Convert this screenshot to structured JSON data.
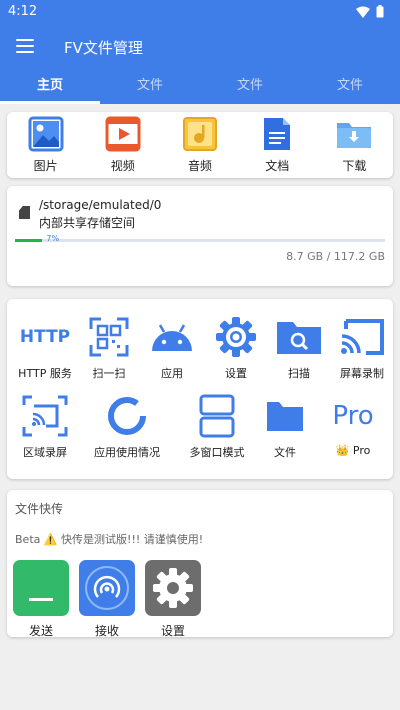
{
  "status": {
    "time": "4:12"
  },
  "app": {
    "title": "FV文件管理"
  },
  "tabs": [
    {
      "label": "主页",
      "active": true
    },
    {
      "label": "文件"
    },
    {
      "label": "文件"
    },
    {
      "label": "文件"
    }
  ],
  "categories": [
    {
      "label": "图片",
      "icon": "image-icon"
    },
    {
      "label": "视频",
      "icon": "video-icon"
    },
    {
      "label": "音频",
      "icon": "audio-icon"
    },
    {
      "label": "文档",
      "icon": "document-icon"
    },
    {
      "label": "下载",
      "icon": "download-folder-icon"
    }
  ],
  "storage": {
    "path": "/storage/emulated/0",
    "name": "内部共享存储空间",
    "used_percent": "7%",
    "used_fraction": 0.074,
    "size_text": "8.7 GB  /  117.2 GB"
  },
  "tools": [
    {
      "label": "HTTP 服务",
      "icon": "http-icon",
      "icon_text": "HTTP"
    },
    {
      "label": "扫一扫",
      "icon": "qr-scan-icon"
    },
    {
      "label": "应用",
      "icon": "android-icon"
    },
    {
      "label": "设置",
      "icon": "gear-icon"
    },
    {
      "label": "扫描",
      "icon": "folder-search-icon"
    },
    {
      "label": "屏幕录制",
      "icon": "cast-icon"
    },
    {
      "label": "区域录屏",
      "icon": "region-record-icon"
    },
    {
      "label": "应用使用情况",
      "icon": "usage-ring-icon"
    },
    {
      "label": "多窗口模式",
      "icon": "split-window-icon"
    },
    {
      "label": "文件",
      "icon": "folder-icon"
    },
    {
      "label": "Pro",
      "icon": "pro-icon",
      "icon_text": "Pro",
      "badge": "👑"
    }
  ],
  "transfer": {
    "title": "文件快传",
    "warning": "Beta ⚠️ 快传是测试版!!! 请谨慎使用!",
    "buttons": [
      {
        "label": "发送",
        "color": "#32b96a"
      },
      {
        "label": "接收",
        "color": "#3f7ee8"
      },
      {
        "label": "设置",
        "color": "#6d6d6d"
      }
    ]
  },
  "colors": {
    "primary": "#3f7ee8",
    "progress": "#1ab84a"
  }
}
